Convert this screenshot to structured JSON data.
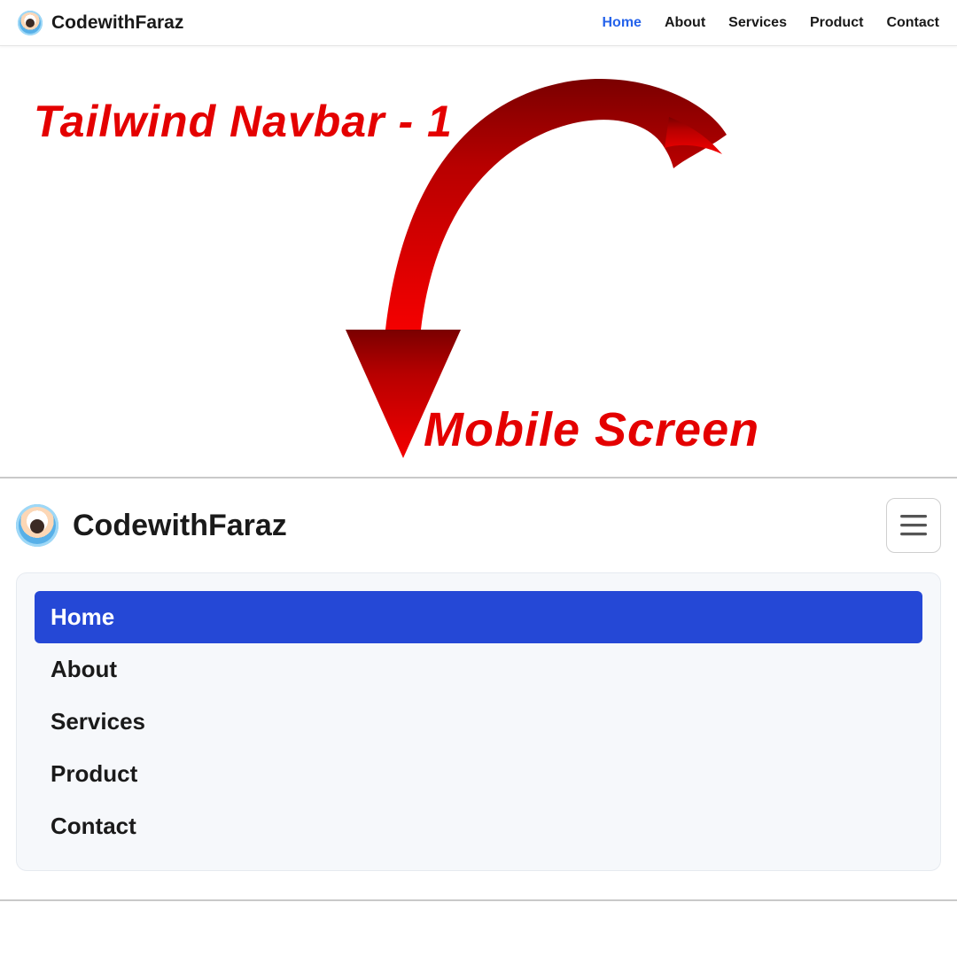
{
  "brand": "CodewithFaraz",
  "nav_items": [
    "Home",
    "About",
    "Services",
    "Product",
    "Contact"
  ],
  "nav_active_index": 0,
  "annotation": {
    "heading_top": "Tailwind Navbar - 1",
    "heading_bottom": "Mobile Screen"
  },
  "mobile": {
    "brand": "CodewithFaraz",
    "menu_items": [
      "Home",
      "About",
      "Services",
      "Product",
      "Contact"
    ],
    "menu_active_index": 0
  },
  "colors": {
    "link_active": "#2563eb",
    "annotation_red": "#e40000",
    "mobile_active_bg": "#2548d6"
  }
}
